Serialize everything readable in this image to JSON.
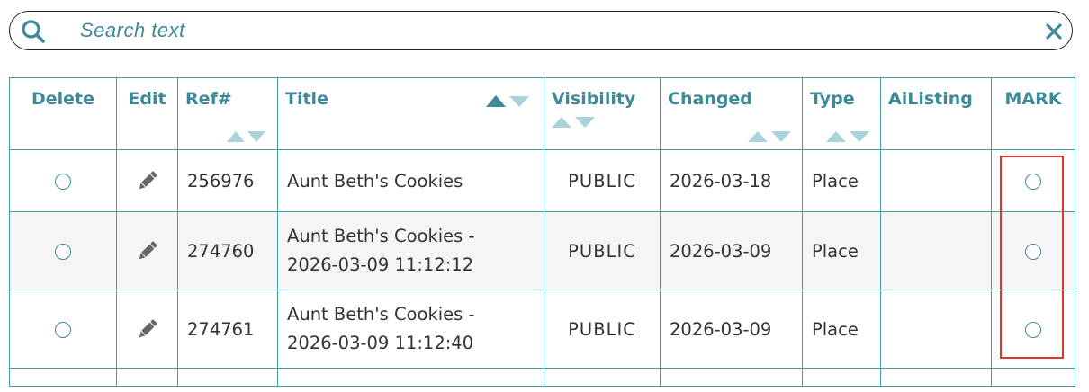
{
  "search": {
    "placeholder": "Search text",
    "value": ""
  },
  "table": {
    "headers": {
      "delete": "Delete",
      "edit": "Edit",
      "ref": "Ref#",
      "title": "Title",
      "visibility": "Visibility",
      "changed": "Changed",
      "type": "Type",
      "ailisting": "AiListing",
      "mark": "MARK"
    },
    "rows": [
      {
        "ref": "256976",
        "title_line1": "Aunt Beth's Cookies",
        "title_line2": "",
        "visibility": "PUBLIC",
        "changed": "2026-03-18",
        "type": "Place",
        "ailisting": ""
      },
      {
        "ref": "274760",
        "title_line1": "Aunt Beth's Cookies -",
        "title_line2": "2026-03-09 11:12:12",
        "visibility": "PUBLIC",
        "changed": "2026-03-09",
        "type": "Place",
        "ailisting": ""
      },
      {
        "ref": "274761",
        "title_line1": "Aunt Beth's Cookies -",
        "title_line2": "2026-03-09 11:12:40",
        "visibility": "PUBLIC",
        "changed": "2026-03-09",
        "type": "Place",
        "ailisting": ""
      }
    ]
  },
  "colors": {
    "accent": "#3d8a99",
    "border": "#4a9aa8",
    "sort_arrow": "#a8d4d9",
    "highlight": "#e0332b",
    "row_alt": "#f5f5f5"
  },
  "icons": {
    "search": "search-icon",
    "clear": "close-icon",
    "edit": "pencil-icon",
    "sort": "sort-arrows-icon"
  }
}
